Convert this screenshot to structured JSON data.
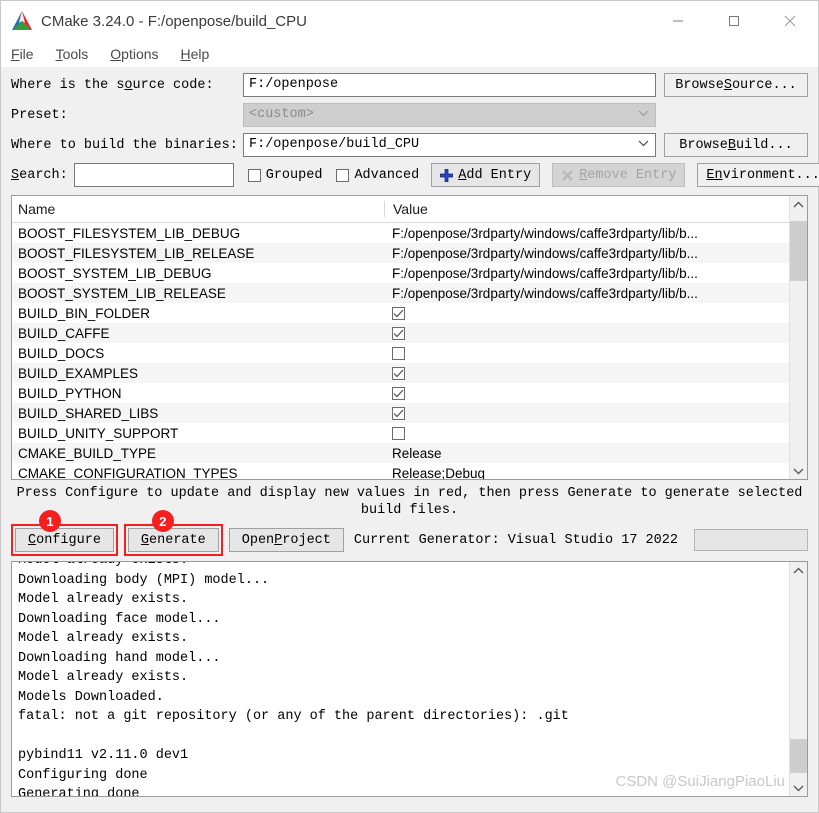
{
  "window": {
    "title": "CMake 3.24.0 - F:/openpose/build_CPU",
    "logo_icon": "cmake-logo-icon",
    "minimize_icon": "minimize-icon",
    "maximize_icon": "maximize-icon",
    "close_icon": "close-icon"
  },
  "menubar": {
    "items": [
      {
        "prefix": "F",
        "rest": "ile"
      },
      {
        "prefix": "T",
        "rest": "ools"
      },
      {
        "prefix": "O",
        "rest": "ptions"
      },
      {
        "prefix": "H",
        "rest": "elp"
      }
    ]
  },
  "form": {
    "source_label_pre": "Where is the s",
    "source_label_key": "o",
    "source_label_post": "urce code:",
    "source_value": "F:/openpose",
    "browse_source_pre": "Browse ",
    "browse_source_key": "S",
    "browse_source_post": "ource...",
    "preset_label": "Preset:",
    "preset_value": "<custom>",
    "build_label": "Where to build the binaries:",
    "build_value": "F:/openpose/build_CPU",
    "browse_build_pre": "Browse ",
    "browse_build_key": "B",
    "browse_build_post": "uild...",
    "search_label_pre": "S",
    "search_label_key": "e",
    "search_label_post": "arch:",
    "search_value": "",
    "search_placeholder": "",
    "grouped_label": "Grouped",
    "advanced_label": "Advanced",
    "add_entry_pre": "",
    "add_entry_key": "A",
    "add_entry_post": "dd Entry",
    "add_entry_icon": "plus-icon",
    "remove_entry_pre": "",
    "remove_entry_key": "R",
    "remove_entry_post": "emove Entry",
    "remove_entry_icon": "remove-x-icon",
    "environment_pre": "E",
    "environment_key": "n",
    "environment_post": "vironment..."
  },
  "table": {
    "columns": [
      "Name",
      "Value"
    ],
    "rows": [
      {
        "name": "BOOST_FILESYSTEM_LIB_DEBUG",
        "value": "F:/openpose/3rdparty/windows/caffe3rdparty/lib/b...",
        "type": "text"
      },
      {
        "name": "BOOST_FILESYSTEM_LIB_RELEASE",
        "value": "F:/openpose/3rdparty/windows/caffe3rdparty/lib/b...",
        "type": "text"
      },
      {
        "name": "BOOST_SYSTEM_LIB_DEBUG",
        "value": "F:/openpose/3rdparty/windows/caffe3rdparty/lib/b...",
        "type": "text"
      },
      {
        "name": "BOOST_SYSTEM_LIB_RELEASE",
        "value": "F:/openpose/3rdparty/windows/caffe3rdparty/lib/b...",
        "type": "text"
      },
      {
        "name": "BUILD_BIN_FOLDER",
        "value": "checked",
        "type": "checkbox"
      },
      {
        "name": "BUILD_CAFFE",
        "value": "checked",
        "type": "checkbox"
      },
      {
        "name": "BUILD_DOCS",
        "value": "unchecked",
        "type": "checkbox"
      },
      {
        "name": "BUILD_EXAMPLES",
        "value": "checked",
        "type": "checkbox"
      },
      {
        "name": "BUILD_PYTHON",
        "value": "checked",
        "type": "checkbox"
      },
      {
        "name": "BUILD_SHARED_LIBS",
        "value": "checked",
        "type": "checkbox"
      },
      {
        "name": "BUILD_UNITY_SUPPORT",
        "value": "unchecked",
        "type": "checkbox"
      },
      {
        "name": "CMAKE_BUILD_TYPE",
        "value": "Release",
        "type": "text"
      },
      {
        "name": "CMAKE_CONFIGURATION_TYPES",
        "value": "Release;Debug",
        "type": "text"
      }
    ],
    "scroll_up_icon": "chevron-up-icon",
    "scroll_down_icon": "chevron-down-icon"
  },
  "hint": {
    "line1": "Press Configure to update and display new values in red, then press Generate to generate selected",
    "line2": "build files."
  },
  "actions": {
    "configure_key": "C",
    "configure_rest": "onfigure",
    "generate_key": "G",
    "generate_rest": "enerate",
    "open_project_pre": "Open ",
    "open_project_key": "P",
    "open_project_post": "roject",
    "generator_text": "Current Generator: Visual Studio 17 2022",
    "badge1": "1",
    "badge2": "2",
    "annotation_color": "#f42020"
  },
  "log": {
    "lines": [
      "Model already exists.",
      "Downloading body (MPI) model...",
      "Model already exists.",
      "Downloading face model...",
      "Model already exists.",
      "Downloading hand model...",
      "Model already exists.",
      "Models Downloaded.",
      "fatal: not a git repository (or any of the parent directories): .git",
      "",
      "pybind11 v2.11.0 dev1",
      "Configuring done",
      "Generating done"
    ]
  },
  "watermark": {
    "text": "CSDN @SuiJiangPiaoLiu"
  }
}
